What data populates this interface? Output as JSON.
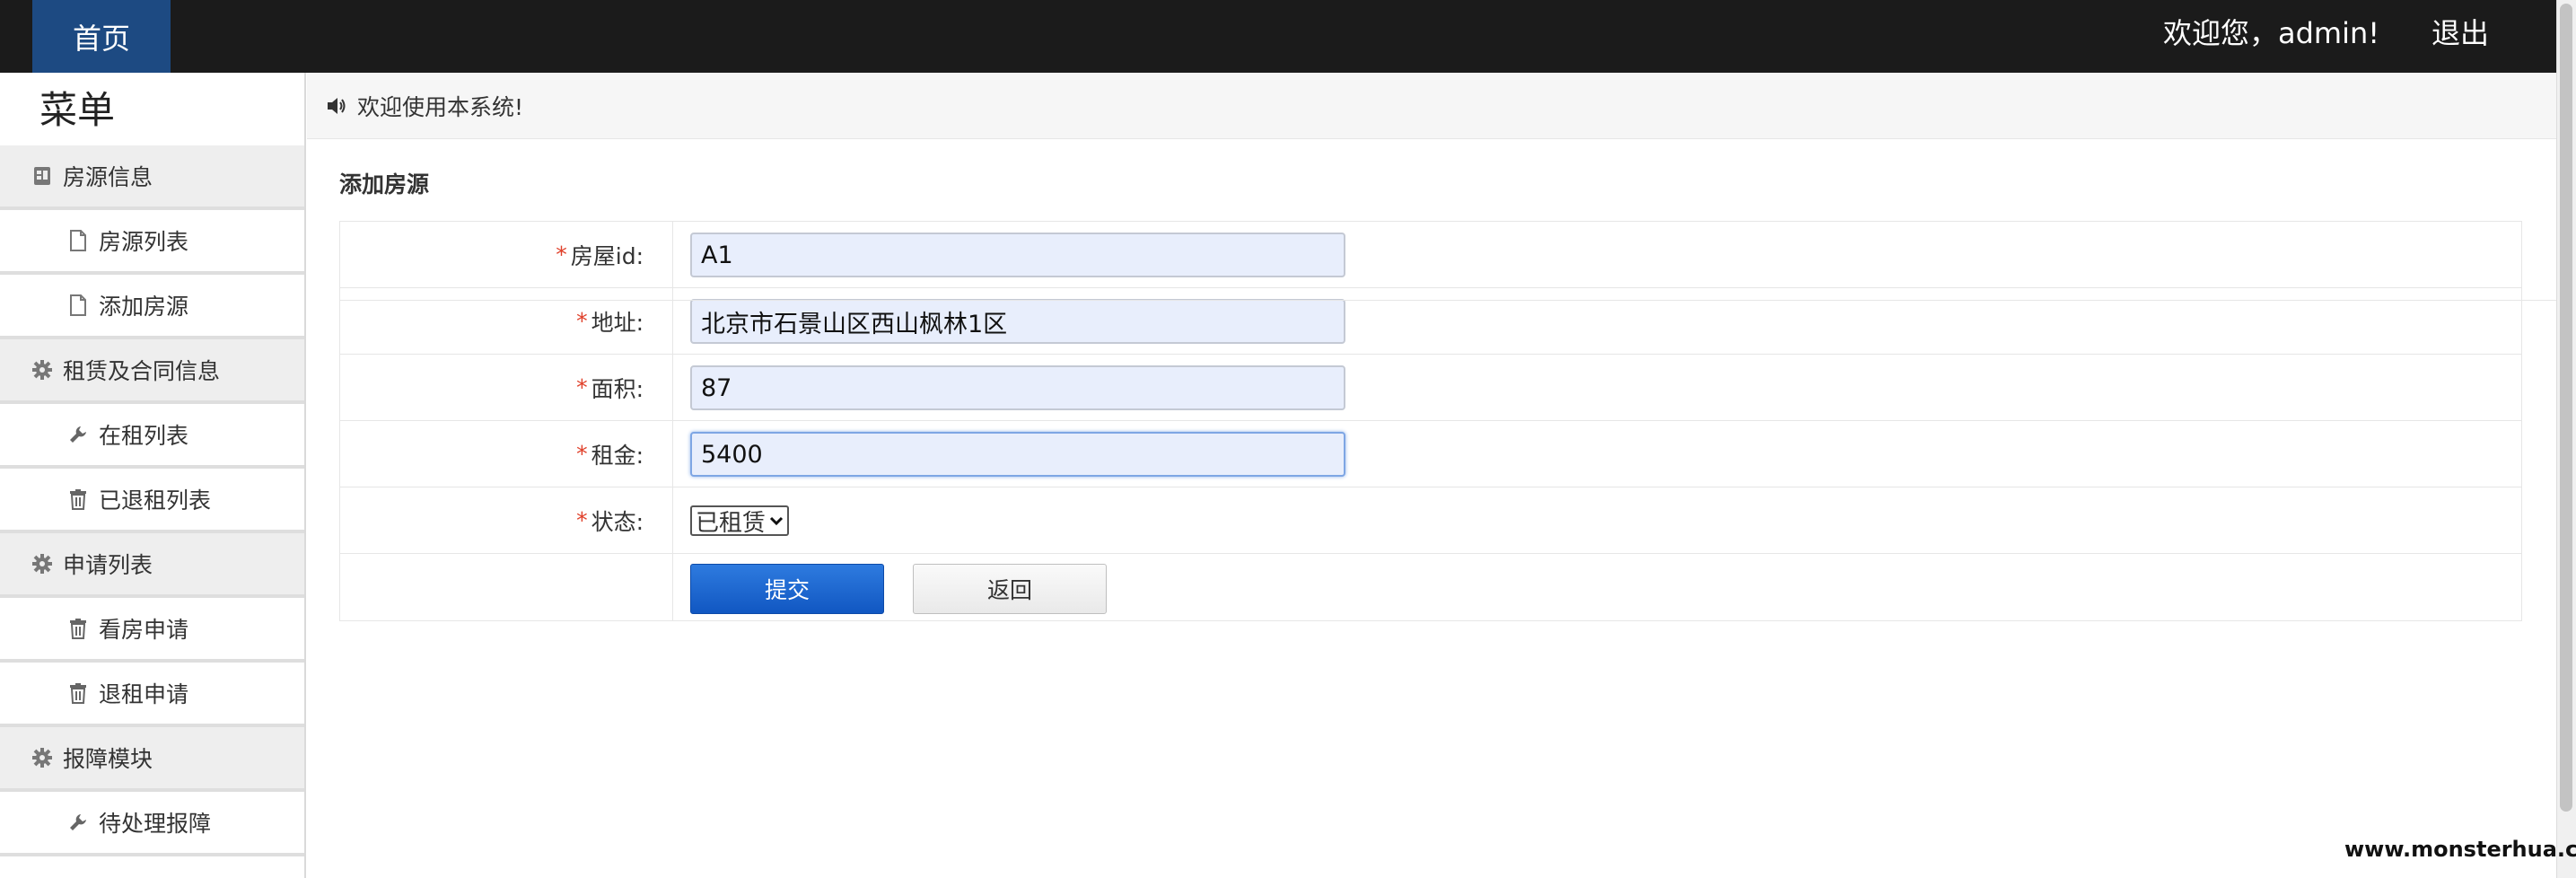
{
  "topbar": {
    "home_label": "首页",
    "welcome_text": "欢迎您，admin!",
    "logout_label": "退出"
  },
  "sidebar": {
    "title": "菜单",
    "items": [
      {
        "label": "房源信息",
        "type": "group",
        "icon": "building-icon"
      },
      {
        "label": "房源列表",
        "type": "item",
        "icon": "file-icon"
      },
      {
        "label": "添加房源",
        "type": "item",
        "icon": "file-icon"
      },
      {
        "label": "租赁及合同信息",
        "type": "group",
        "icon": "gear-icon"
      },
      {
        "label": "在租列表",
        "type": "item",
        "icon": "wrench-icon"
      },
      {
        "label": "已退租列表",
        "type": "item",
        "icon": "trash-icon"
      },
      {
        "label": "申请列表",
        "type": "group",
        "icon": "gear-icon"
      },
      {
        "label": "看房申请",
        "type": "item",
        "icon": "trash-icon"
      },
      {
        "label": "退租申请",
        "type": "item",
        "icon": "trash-icon"
      },
      {
        "label": "报障模块",
        "type": "group",
        "icon": "gear-icon"
      },
      {
        "label": "待处理报障",
        "type": "item",
        "icon": "wrench-icon"
      }
    ]
  },
  "notice": {
    "text": "欢迎使用本系统!",
    "icon": "speaker-icon"
  },
  "form": {
    "title": "添加房源",
    "fields": {
      "house_id": {
        "label": "房屋id:",
        "value": "A1"
      },
      "address": {
        "label": "地址:",
        "value": "北京市石景山区西山枫林1区"
      },
      "area": {
        "label": "面积:",
        "value": "87"
      },
      "rent": {
        "label": "租金:",
        "value": "5400"
      },
      "status": {
        "label": "状态:",
        "selected": "已租赁"
      }
    },
    "required_mark": "*",
    "submit_label": "提交",
    "back_label": "返回"
  },
  "watermark": "www.monsterhua.com",
  "colors": {
    "topbar": "#1b1b1b",
    "home_tab": "#1d4a82",
    "submit_button": "#1566d0",
    "required": "#e0402a",
    "input_fill": "#e8eefc"
  }
}
